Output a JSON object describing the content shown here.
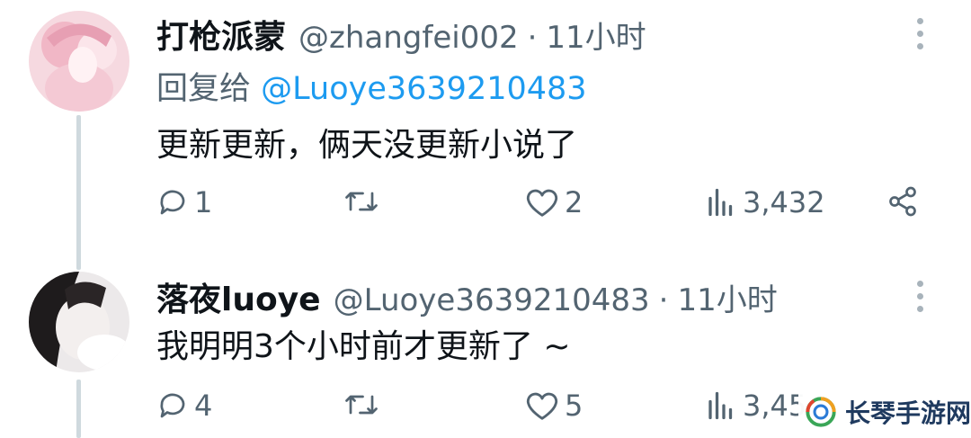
{
  "tweets": [
    {
      "name": "打枪派蒙",
      "handle": "@zhangfei002",
      "dot": "·",
      "time": "11小时",
      "reply_prefix": "回复给 ",
      "reply_handle": "@Luoye3639210483",
      "text": "更新更新，俩天没更新小说了",
      "replies": "1",
      "retweets": "",
      "likes": "2",
      "views": "3,432"
    },
    {
      "name": "落夜luoye",
      "handle": "@Luoye3639210483",
      "dot": "·",
      "time": "11小时",
      "text": "我明明3个小时前才更新了 ~",
      "replies": "4",
      "retweets": "",
      "likes": "5",
      "views": "3,45"
    }
  ],
  "watermark": {
    "text": "长琴手游网"
  },
  "colors": {
    "link": "#1d9bf0",
    "muted": "#536471",
    "thread": "#cfd9de"
  }
}
